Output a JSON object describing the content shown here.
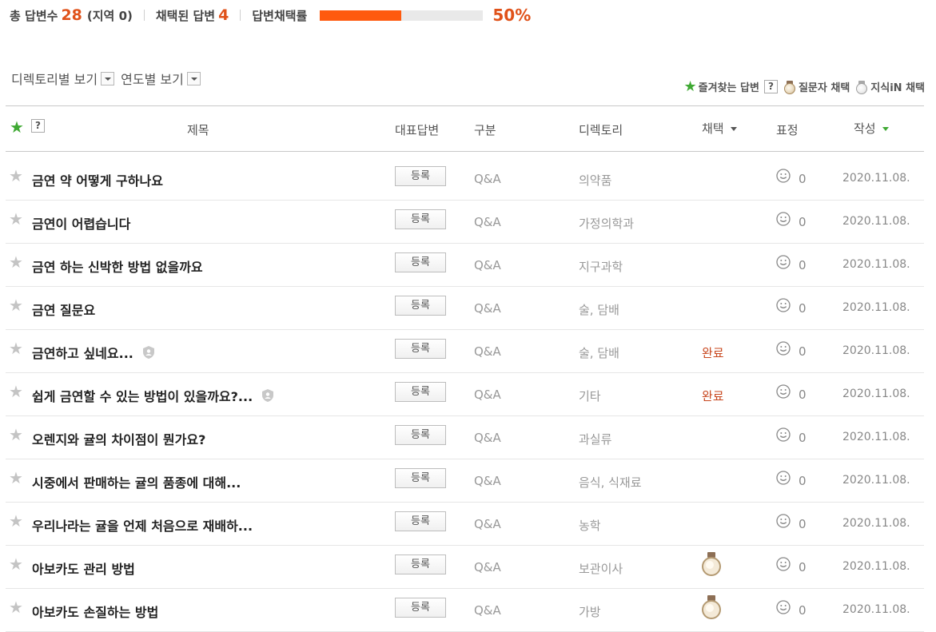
{
  "stats": {
    "total_label": "총 답변수",
    "total_value": "28",
    "region_text": "(지역 0)",
    "adopted_label": "채택된 답변",
    "adopted_value": "4",
    "rate_label": "답변채택률",
    "rate_text": "50%",
    "rate_fraction": 0.5,
    "accent_color": "#e0521a",
    "bar_color": "#ff5a0e"
  },
  "views": {
    "directory_label": "디렉토리별 보기",
    "year_label": "연도별 보기"
  },
  "legend": {
    "favorite_label": "즐겨찾는 답변",
    "help_label": "?",
    "questioner_label": "질문자 채택",
    "jisik_label": "지식iN 채택"
  },
  "table": {
    "headers": {
      "help": "?",
      "title": "제목",
      "rep_answer": "대표답변",
      "category": "구분",
      "directory": "디렉토리",
      "adopted": "채택",
      "expression": "표정",
      "written": "작성"
    },
    "register_label": "등록",
    "rows": [
      {
        "title": "금연 약 어떻게 구하나요",
        "category": "Q&A",
        "directory": "의약품",
        "adopted": "",
        "medal": false,
        "private": false,
        "count": "0",
        "date": "2020.11.08."
      },
      {
        "title": "금연이 어렵습니다",
        "category": "Q&A",
        "directory": "가정의학과",
        "adopted": "",
        "medal": false,
        "private": false,
        "count": "0",
        "date": "2020.11.08."
      },
      {
        "title": "금연 하는 신박한 방법 없을까요",
        "category": "Q&A",
        "directory": "지구과학",
        "adopted": "",
        "medal": false,
        "private": false,
        "count": "0",
        "date": "2020.11.08."
      },
      {
        "title": "금연 질문요",
        "category": "Q&A",
        "directory": "술, 담배",
        "adopted": "",
        "medal": false,
        "private": false,
        "count": "0",
        "date": "2020.11.08."
      },
      {
        "title": "금연하고 싶네요...",
        "category": "Q&A",
        "directory": "술, 담배",
        "adopted": "완료",
        "medal": false,
        "private": true,
        "count": "0",
        "date": "2020.11.08."
      },
      {
        "title": "쉽게 금연할 수 있는 방법이 있을까요?...",
        "category": "Q&A",
        "directory": "기타",
        "adopted": "완료",
        "medal": false,
        "private": true,
        "count": "0",
        "date": "2020.11.08."
      },
      {
        "title": "오렌지와 귤의 차이점이 뭔가요?",
        "category": "Q&A",
        "directory": "과실류",
        "adopted": "",
        "medal": false,
        "private": false,
        "count": "0",
        "date": "2020.11.08."
      },
      {
        "title": "시중에서 판매하는 귤의 품종에 대해...",
        "category": "Q&A",
        "directory": "음식, 식재료",
        "adopted": "",
        "medal": false,
        "private": false,
        "count": "0",
        "date": "2020.11.08."
      },
      {
        "title": "우리나라는 귤을 언제 처음으로 재배하...",
        "category": "Q&A",
        "directory": "농학",
        "adopted": "",
        "medal": false,
        "private": false,
        "count": "0",
        "date": "2020.11.08."
      },
      {
        "title": "아보카도 관리 방법",
        "category": "Q&A",
        "directory": "보관이사",
        "adopted": "",
        "medal": true,
        "private": false,
        "count": "0",
        "date": "2020.11.08."
      },
      {
        "title": "아보카도 손질하는 방법",
        "category": "Q&A",
        "directory": "가방",
        "adopted": "",
        "medal": true,
        "private": false,
        "count": "0",
        "date": "2020.11.08."
      }
    ]
  }
}
